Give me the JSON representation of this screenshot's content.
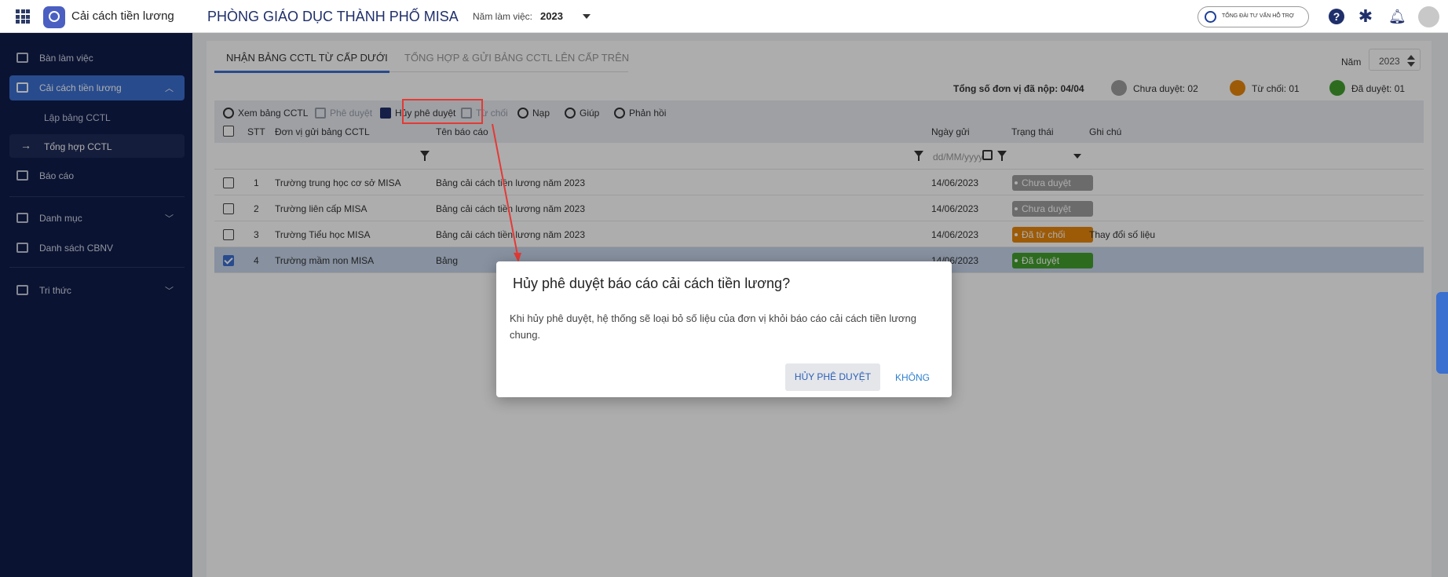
{
  "app": {
    "name": "Cải cách tiền lương",
    "org_name": "PHÒNG GIÁO DỤC THÀNH PHỐ MISA",
    "year_label": "Năm làm việc:",
    "year_value": "2023",
    "hotline": "TỔNG ĐÀI TƯ VẤN HỖ TRỢ"
  },
  "sidebar": {
    "items": [
      {
        "label": "Bàn làm việc"
      },
      {
        "label": "Cải cách tiền lương"
      },
      {
        "label": "Lập bảng CCTL"
      },
      {
        "label": "Tổng hợp CCTL"
      },
      {
        "label": "Báo cáo"
      },
      {
        "label": "Danh mục"
      },
      {
        "label": "Danh sách CBNV"
      },
      {
        "label": "Tri thức"
      }
    ]
  },
  "tabs": [
    {
      "label": "NHẬN BẢNG CCTL TỪ CẤP DƯỚI"
    },
    {
      "label": "TỔNG HỢP & GỬI BẢNG CCTL LÊN CẤP TRÊN"
    }
  ],
  "year_filter": {
    "label": "Năm",
    "value": "2023"
  },
  "summary": {
    "total": "Tổng số đơn vị đã nộp: 04/04",
    "pending": "Chưa duyệt: 02",
    "rejected": "Từ chối: 01",
    "approved": "Đã duyệt: 01",
    "colors": {
      "pending": "#9e9e9e",
      "rejected": "#e8860c",
      "approved": "#43a02e"
    }
  },
  "toolbar": {
    "view": "Xem bảng CCTL",
    "approve": "Phê duyệt",
    "cancel_approve": "Hủy phê duyệt",
    "reject": "Từ chối",
    "reload": "Nạp",
    "help": "Giúp",
    "feedback": "Phản hồi"
  },
  "table": {
    "headers": {
      "stt": "STT",
      "unit": "Đơn vị gửi bảng CCTL",
      "report": "Tên báo cáo",
      "date": "Ngày gửi",
      "status": "Trạng thái",
      "note": "Ghi chú"
    },
    "date_placeholder": "dd/MM/yyyy",
    "rows": [
      {
        "stt": "1",
        "unit": "Trường trung học cơ sở MISA",
        "report": "Bảng cải cách tiền lương năm 2023",
        "date": "14/06/2023",
        "status": "Chưa duyệt",
        "note": ""
      },
      {
        "stt": "2",
        "unit": "Trường liên cấp MISA",
        "report": "Bảng cải cách tiền lương năm 2023",
        "date": "14/06/2023",
        "status": "Chưa duyệt",
        "note": ""
      },
      {
        "stt": "3",
        "unit": "Trường Tiểu học MISA",
        "report": "Bảng cải cách tiền lương năm 2023",
        "date": "14/06/2023",
        "status": "Đã từ chối",
        "note": "Thay đổi số liệu"
      },
      {
        "stt": "4",
        "unit": "Trường mầm non MISA",
        "report": "Bảng",
        "date": "14/06/2023",
        "status": "Đã duyệt",
        "note": ""
      }
    ]
  },
  "dialog": {
    "title": "Hủy phê duyệt báo cáo cải cách tiền lương?",
    "body": "Khi hủy phê duyệt, hệ thống sẽ loại bỏ số liệu của đơn vị khỏi báo cáo cải cách tiền lương chung.",
    "confirm": "HỦY PHÊ DUYỆT",
    "cancel": "KHÔNG"
  }
}
